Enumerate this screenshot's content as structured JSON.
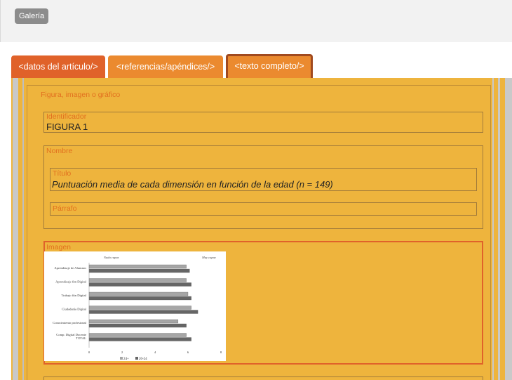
{
  "toolbar": {
    "gallery_label": "Galería"
  },
  "tabs": [
    {
      "label": "<datos del artículo/>"
    },
    {
      "label": "<referencias/apéndices/>"
    },
    {
      "label": "<texto completo/>"
    }
  ],
  "section": {
    "title": "Figura, imagen o gráfico",
    "identifier": {
      "label": "Identificador",
      "value": "FIGURA 1"
    },
    "name": {
      "label": "Nombre",
      "title": {
        "label": "Título",
        "value": "Puntuación media de cada dimensión en función de la edad (n = 149)"
      },
      "paragraph": {
        "label": "Párrafo",
        "value": ""
      }
    },
    "image": {
      "label": "Imagen"
    }
  },
  "colors": {
    "panel": "#eeb43d",
    "tab_active": "#e0622a",
    "tab": "#eb8a2f",
    "label": "#e2701f"
  },
  "chart_data": {
    "type": "bar",
    "orientation": "horizontal",
    "header_left": "Nada capaz",
    "header_right": "Muy capaz",
    "categories": [
      "Aprendizaje de Alumnos",
      "Aprendizaje fitn Digital",
      "Trabajo fitn Digital",
      "Ciudadanía Digital",
      "Conocimiento profesional",
      "Comp. Digital Docente TOTAL"
    ],
    "series": [
      {
        "name": "24+",
        "values": [
          5.9,
          5.9,
          6.0,
          6.2,
          5.4,
          5.9
        ]
      },
      {
        "name": "20-24",
        "values": [
          6.1,
          6.2,
          6.2,
          6.6,
          5.9,
          6.2
        ]
      }
    ],
    "xticks": [
      "0",
      "2",
      "4",
      "6",
      "8"
    ],
    "xlim": [
      0,
      8
    ],
    "series_colors": [
      "#a6a6a6",
      "#666666"
    ]
  }
}
